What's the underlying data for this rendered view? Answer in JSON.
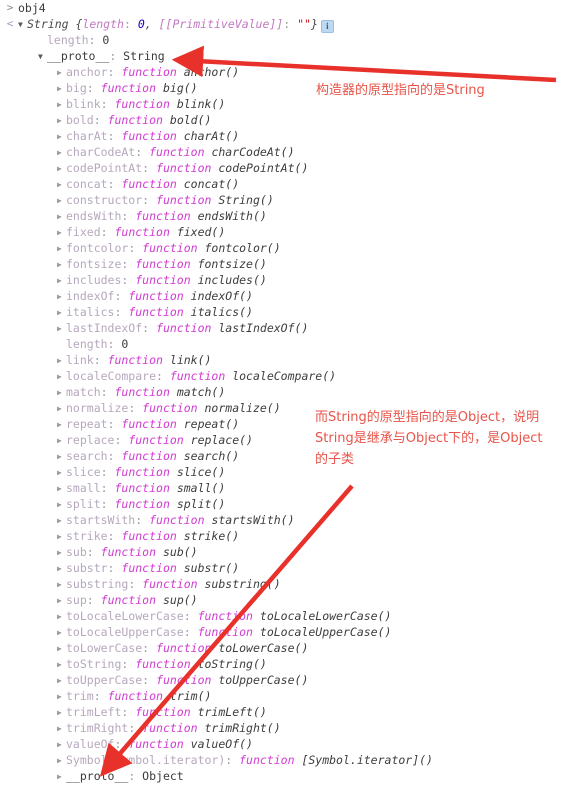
{
  "console": {
    "input_marker": ">",
    "result_marker": "<",
    "input_expression": "obj4",
    "result_preview": {
      "constructor_name": "String",
      "open_brace": "{",
      "length_key": "length",
      "length_value": "0",
      "separator": ", ",
      "primitive_key": "[[PrimitiveValue]]",
      "primitive_value": "\"\"",
      "close_brace": "}",
      "info_icon": "info-icon",
      "info_icon_glyph": "i"
    },
    "own_properties": [
      {
        "expander": "none",
        "key": "length",
        "value": "0",
        "kind": "number"
      }
    ],
    "proto_row": {
      "expander": "open",
      "key": "__proto__",
      "value": "String",
      "kind": "plain"
    },
    "proto_properties": [
      {
        "expander": "closed",
        "key": "anchor",
        "keyword": "function",
        "value": "anchor()"
      },
      {
        "expander": "closed",
        "key": "big",
        "keyword": "function",
        "value": "big()"
      },
      {
        "expander": "closed",
        "key": "blink",
        "keyword": "function",
        "value": "blink()"
      },
      {
        "expander": "closed",
        "key": "bold",
        "keyword": "function",
        "value": "bold()"
      },
      {
        "expander": "closed",
        "key": "charAt",
        "keyword": "function",
        "value": "charAt()"
      },
      {
        "expander": "closed",
        "key": "charCodeAt",
        "keyword": "function",
        "value": "charCodeAt()"
      },
      {
        "expander": "closed",
        "key": "codePointAt",
        "keyword": "function",
        "value": "codePointAt()"
      },
      {
        "expander": "closed",
        "key": "concat",
        "keyword": "function",
        "value": "concat()"
      },
      {
        "expander": "closed",
        "key": "constructor",
        "keyword": "function",
        "value": "String()"
      },
      {
        "expander": "closed",
        "key": "endsWith",
        "keyword": "function",
        "value": "endsWith()"
      },
      {
        "expander": "closed",
        "key": "fixed",
        "keyword": "function",
        "value": "fixed()"
      },
      {
        "expander": "closed",
        "key": "fontcolor",
        "keyword": "function",
        "value": "fontcolor()"
      },
      {
        "expander": "closed",
        "key": "fontsize",
        "keyword": "function",
        "value": "fontsize()"
      },
      {
        "expander": "closed",
        "key": "includes",
        "keyword": "function",
        "value": "includes()"
      },
      {
        "expander": "closed",
        "key": "indexOf",
        "keyword": "function",
        "value": "indexOf()"
      },
      {
        "expander": "closed",
        "key": "italics",
        "keyword": "function",
        "value": "italics()"
      },
      {
        "expander": "closed",
        "key": "lastIndexOf",
        "keyword": "function",
        "value": "lastIndexOf()"
      },
      {
        "expander": "none",
        "key": "length",
        "keyword": "",
        "value": "0"
      },
      {
        "expander": "closed",
        "key": "link",
        "keyword": "function",
        "value": "link()"
      },
      {
        "expander": "closed",
        "key": "localeCompare",
        "keyword": "function",
        "value": "localeCompare()"
      },
      {
        "expander": "closed",
        "key": "match",
        "keyword": "function",
        "value": "match()"
      },
      {
        "expander": "closed",
        "key": "normalize",
        "keyword": "function",
        "value": "normalize()"
      },
      {
        "expander": "closed",
        "key": "repeat",
        "keyword": "function",
        "value": "repeat()"
      },
      {
        "expander": "closed",
        "key": "replace",
        "keyword": "function",
        "value": "replace()"
      },
      {
        "expander": "closed",
        "key": "search",
        "keyword": "function",
        "value": "search()"
      },
      {
        "expander": "closed",
        "key": "slice",
        "keyword": "function",
        "value": "slice()"
      },
      {
        "expander": "closed",
        "key": "small",
        "keyword": "function",
        "value": "small()"
      },
      {
        "expander": "closed",
        "key": "split",
        "keyword": "function",
        "value": "split()"
      },
      {
        "expander": "closed",
        "key": "startsWith",
        "keyword": "function",
        "value": "startsWith()"
      },
      {
        "expander": "closed",
        "key": "strike",
        "keyword": "function",
        "value": "strike()"
      },
      {
        "expander": "closed",
        "key": "sub",
        "keyword": "function",
        "value": "sub()"
      },
      {
        "expander": "closed",
        "key": "substr",
        "keyword": "function",
        "value": "substr()"
      },
      {
        "expander": "closed",
        "key": "substring",
        "keyword": "function",
        "value": "substring()"
      },
      {
        "expander": "closed",
        "key": "sup",
        "keyword": "function",
        "value": "sup()"
      },
      {
        "expander": "closed",
        "key": "toLocaleLowerCase",
        "keyword": "function",
        "value": "toLocaleLowerCase()"
      },
      {
        "expander": "closed",
        "key": "toLocaleUpperCase",
        "keyword": "function",
        "value": "toLocaleUpperCase()"
      },
      {
        "expander": "closed",
        "key": "toLowerCase",
        "keyword": "function",
        "value": "toLowerCase()"
      },
      {
        "expander": "closed",
        "key": "toString",
        "keyword": "function",
        "value": "toString()"
      },
      {
        "expander": "closed",
        "key": "toUpperCase",
        "keyword": "function",
        "value": "toUpperCase()"
      },
      {
        "expander": "closed",
        "key": "trim",
        "keyword": "function",
        "value": "trim()"
      },
      {
        "expander": "closed",
        "key": "trimLeft",
        "keyword": "function",
        "value": "trimLeft()"
      },
      {
        "expander": "closed",
        "key": "trimRight",
        "keyword": "function",
        "value": "trimRight()"
      },
      {
        "expander": "closed",
        "key": "valueOf",
        "keyword": "function",
        "value": "valueOf()"
      },
      {
        "expander": "closed",
        "key": "Symbol(Symbol.iterator)",
        "keyword": "function",
        "value": "[Symbol.iterator]()"
      },
      {
        "expander": "closed",
        "key": "__proto__",
        "keyword": "",
        "value": "Object"
      }
    ]
  },
  "annotations": {
    "accent_color": "#e8544a",
    "items": [
      {
        "id": "annot-1",
        "text": "构造器的原型指向的是String"
      },
      {
        "id": "annot-2",
        "text": "而String的原型指向的是Object，说明String是继承与Object下的，是Object的子类"
      }
    ]
  }
}
